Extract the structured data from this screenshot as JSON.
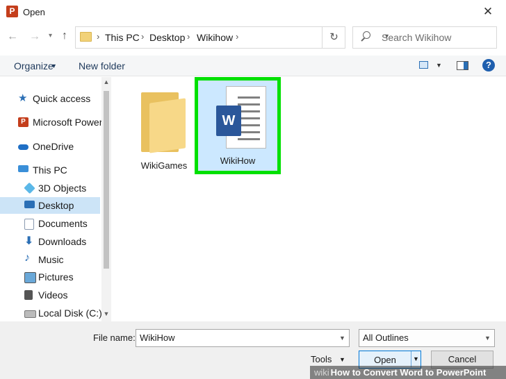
{
  "window": {
    "title": "Open",
    "app_icon": "powerpoint-icon",
    "close_glyph": "✕"
  },
  "address": {
    "path": [
      "This PC",
      "Desktop",
      "Wikihow"
    ],
    "separator": "›",
    "search_placeholder": "Search Wikihow"
  },
  "toolbar": {
    "organize": "Organize",
    "new_folder": "New folder"
  },
  "nav": {
    "items": [
      {
        "label": "Quick access",
        "icon": "star-icon",
        "color": "#2b6fb5"
      },
      {
        "label": "Microsoft PowerP",
        "icon": "powerpoint-icon",
        "color": "#c43e1c"
      },
      {
        "label": "OneDrive",
        "icon": "cloud-icon",
        "color": "#1f6fc5"
      },
      {
        "label": "This PC",
        "icon": "computer-icon",
        "color": "#3a8fd8"
      },
      {
        "label": "3D Objects",
        "icon": "cube-icon",
        "color": "#5bb8e8"
      },
      {
        "label": "Desktop",
        "icon": "desktop-icon",
        "color": "#2b6fb5",
        "selected": true
      },
      {
        "label": "Documents",
        "icon": "document-icon",
        "color": "#8a9ab0"
      },
      {
        "label": "Downloads",
        "icon": "download-icon",
        "color": "#2b6fb5"
      },
      {
        "label": "Music",
        "icon": "music-icon",
        "color": "#2b6fb5"
      },
      {
        "label": "Pictures",
        "icon": "pictures-icon",
        "color": "#6aa8d8"
      },
      {
        "label": "Videos",
        "icon": "videos-icon",
        "color": "#555555"
      },
      {
        "label": "Local Disk (C:)",
        "icon": "disk-icon",
        "color": "#777777"
      }
    ]
  },
  "files": [
    {
      "name": "WikiGames",
      "type": "folder"
    },
    {
      "name": "WikiHow",
      "type": "word-document",
      "badge": "W",
      "selected": true
    }
  ],
  "bottom": {
    "filename_label": "File name:",
    "filename_value": "WikiHow",
    "filetype_value": "All Outlines",
    "tools": "Tools",
    "open": "Open",
    "cancel": "Cancel"
  },
  "watermark": {
    "prefix": "wiki",
    "text": "How to Convert Word to PowerPoint"
  },
  "colors": {
    "highlight": "#00e000",
    "selection": "#cce8ff",
    "accent": "#0078d7"
  }
}
